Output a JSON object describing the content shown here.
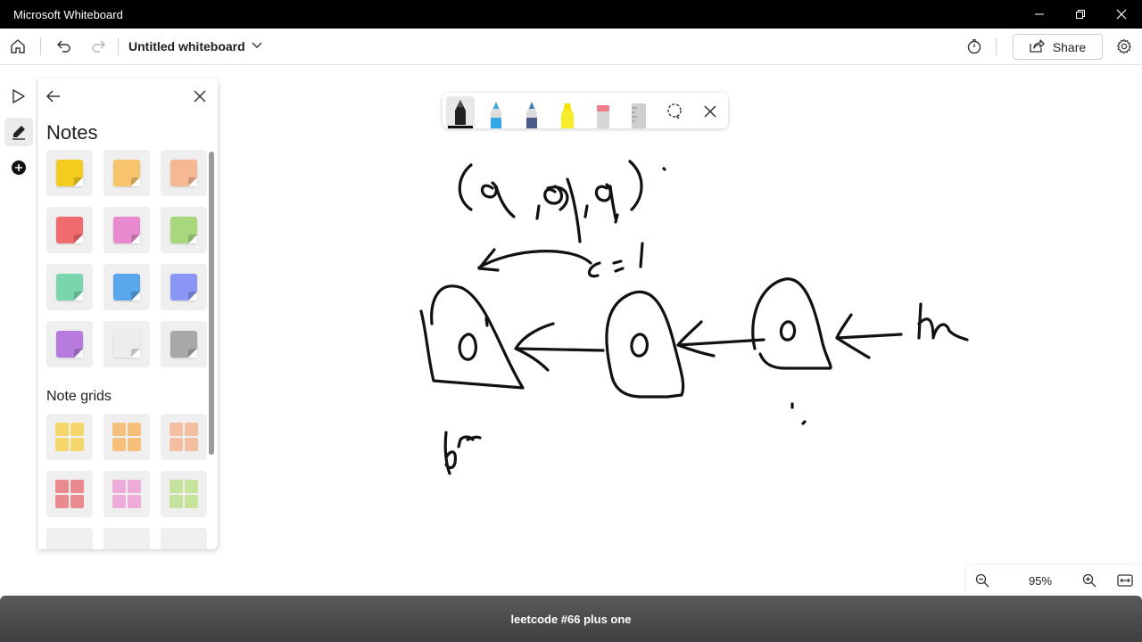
{
  "window": {
    "title": "Microsoft Whiteboard"
  },
  "header": {
    "board_title": "Untitled whiteboard",
    "share_label": "Share"
  },
  "panel": {
    "heading": "Notes",
    "grids_heading": "Note grids",
    "note_colors": [
      "#f5cc1e",
      "#f7c46b",
      "#f6b892",
      "#ef6b6e",
      "#e98ad0",
      "#a9d87c",
      "#79d6ac",
      "#5aa6ec",
      "#8a96f4",
      "#b77be0",
      "#ededed",
      "#a8a8a8"
    ],
    "grid_colors": [
      "#f5d66b",
      "#f5c17a",
      "#f3bfa0",
      "#ea8a8e",
      "#eeabd8",
      "#c6e39c"
    ]
  },
  "zoom": {
    "level": "95%"
  },
  "caption": {
    "text": "leetcode #66 plus one"
  }
}
